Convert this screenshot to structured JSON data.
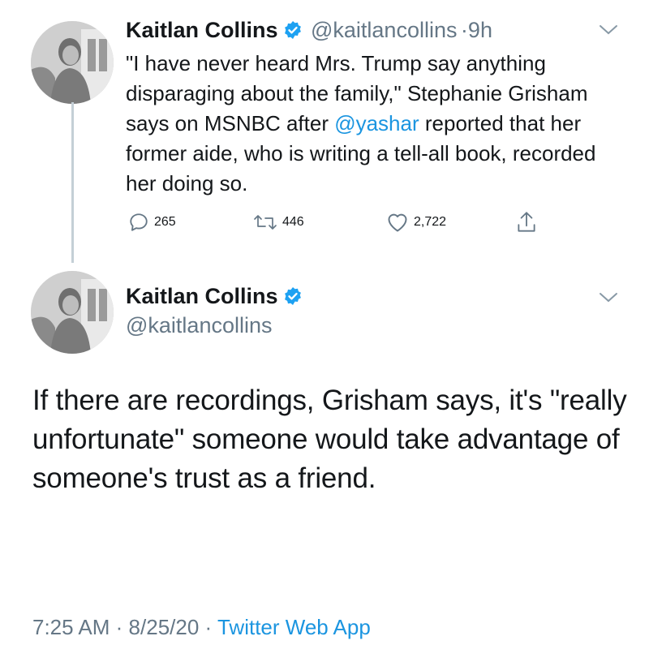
{
  "colors": {
    "link": "#1b95e0",
    "muted": "#657786",
    "verified": "#1da1f2",
    "text": "#14171a"
  },
  "tweet1": {
    "name": "Kaitlan Collins",
    "handle": "@kaitlancollins",
    "separator": "·",
    "time": "9h",
    "text_before_mention": "\"I have never heard Mrs. Trump say anything disparaging about the family,\" Stephanie Grisham says on MSNBC after ",
    "mention": "@yashar",
    "text_after_mention": " reported that her former aide, who is writing a tell-all book, recorded her doing so.",
    "replies": "265",
    "retweets": "446",
    "likes": "2,722",
    "icons": [
      "verified-badge-icon",
      "chevron-down-icon",
      "reply-icon",
      "retweet-icon",
      "like-icon",
      "share-icon"
    ]
  },
  "tweet2": {
    "name": "Kaitlan Collins",
    "handle": "@kaitlancollins",
    "text": "If there are recordings, Grisham says, it's \"really unfortunate\" someone would take advantage of someone's trust as a friend.",
    "time": "7:25 AM",
    "date": "8/25/20",
    "separator": "·",
    "source": "Twitter Web App",
    "icons": [
      "verified-badge-icon",
      "chevron-down-icon"
    ]
  }
}
